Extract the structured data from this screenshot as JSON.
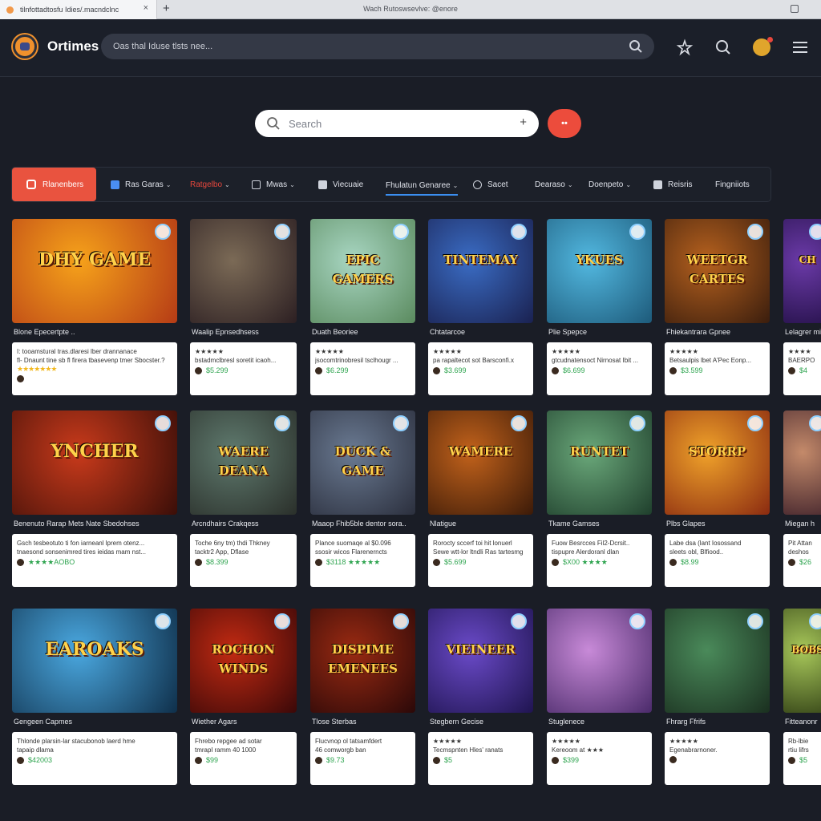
{
  "browser": {
    "tab_title": "tilnfottadtosfu Idies/.macndclnc",
    "tab_close": "×",
    "new_tab": "+",
    "window_title": "Wach Rutoswsevlve: @enore"
  },
  "header": {
    "brand": "Ortimes",
    "search_placeholder": "Oas thal Iduse tlsts nee..."
  },
  "main_search": {
    "placeholder": "Search",
    "add": "+",
    "go_label": "••"
  },
  "categories": {
    "active": "Rlanenbers",
    "items": [
      {
        "label": "Ras Garas",
        "chevron": "⌄",
        "icon_color": "#4a8ef2"
      },
      {
        "label": "Ratgelbo",
        "chevron": "⌄",
        "icon_color": "",
        "accent": "#e8473c"
      },
      {
        "label": "Mwas",
        "chevron": "⌄",
        "icon_color": "#cfd3dc"
      },
      {
        "label": "Viecuaie",
        "chevron": "",
        "icon_color": "#cfd3dc"
      },
      {
        "label": "Fhulatun Genaree",
        "chevron": "⌄",
        "icon_color": ""
      },
      {
        "label": "Sacet",
        "chevron": "",
        "icon_color": "#cfd3dc"
      },
      {
        "label": "Dearaso",
        "chevron": "⌄",
        "icon_color": ""
      },
      {
        "label": "Doenpeto",
        "chevron": "⌄",
        "icon_color": ""
      },
      {
        "label": "Reisris",
        "chevron": "",
        "icon_color": "#cfd3dc"
      },
      {
        "label": "Fingniiots",
        "chevron": "",
        "icon_color": ""
      }
    ]
  },
  "games": [
    {
      "title": "Blone Epecertpte ..",
      "art": "DHY GAME",
      "colors": [
        "#f6a21a",
        "#b53b16"
      ],
      "line1": "I: tooamstural tras.dlaresi lber drannanace",
      "line2": "fl- Dnaunt tine sb fl firera tbasevenp tmer Sbocster.?",
      "stars": "★★★★★★★",
      "price": ""
    },
    {
      "title": "Waalip Epnsedhsess",
      "art": "",
      "colors": [
        "#7b6a56",
        "#2c1f22"
      ],
      "line1": "★★★★★",
      "line2": "bstadmclbresl soretit icaoh...",
      "stars": "",
      "price": "$5.299"
    },
    {
      "title": "Duath Beoriee",
      "art": "EPIC GAMERS",
      "colors": [
        "#a8d6c2",
        "#5a8a5e"
      ],
      "line1": "★★★★★",
      "line2": "jsocomtrinobresil tsclhougr ...",
      "stars": "",
      "price": "$6.299"
    },
    {
      "title": "Chtatarcoe",
      "art": "TINTEMAY",
      "colors": [
        "#3a6cc4",
        "#1a2150"
      ],
      "line1": "★★★★★",
      "line2": "pa rapaltecot sot Barsconfi.x",
      "stars": "",
      "price": "$3.699"
    },
    {
      "title": "Plie Spepce",
      "art": "YKUES",
      "colors": [
        "#52b8e0",
        "#1d5a7a"
      ],
      "line1": "★★★★★",
      "line2": "gtcudnatensoct Nirnosat Ibit ...",
      "stars": "",
      "price": "$6.699"
    },
    {
      "title": "Fhiekantrara Gpnee",
      "art": "WEETGR CARTES",
      "colors": [
        "#b6611e",
        "#3a1d0d"
      ],
      "line1": "★★★★★",
      "line2": "Betsaulpis lbet A'Pec Eonp...",
      "stars": "",
      "price": "$3.599"
    },
    {
      "title": "Lelagrer mi",
      "art": "CH",
      "colors": [
        "#6b3aa8",
        "#2a1450"
      ],
      "line1": "★★★★",
      "line2": "BAERPO",
      "stars": "",
      "price": "$4"
    },
    {
      "title": "Benenuto Rarap Mets Nate Sbedohses",
      "art": "YNCHER",
      "colors": [
        "#c93a1b",
        "#3a0e08"
      ],
      "line1": "Gsch tesbeotuto ti fon iarneanl lprem otenz...",
      "line2": "tnaesond sonsenimred tires ieidas mam nst...",
      "stars": "",
      "price": "★★★★AOBO"
    },
    {
      "title": "Arcndhairs Crakqess",
      "art": "WAERE DEANA",
      "colors": [
        "#5f7a6e",
        "#2a2f2a"
      ],
      "line1": "Toche 6ny tm) thdi Thkney",
      "line2": "tacktr2 App, Dflase",
      "stars": "",
      "price": "$8.399"
    },
    {
      "title": "Maaop Fhib5ble dentor sora..",
      "art": "DUCK & GAME",
      "colors": [
        "#6a7a92",
        "#2b2f3d"
      ],
      "line1": "Plance suomaqe al $0.096",
      "line2": "ssosir wicos Flarenerncts",
      "stars": "",
      "price": "$3118 ★★★★★"
    },
    {
      "title": "Nlatigue",
      "art": "WAMERE",
      "colors": [
        "#c2621b",
        "#3b1a08"
      ],
      "line1": "Rorocty sccerf toi hit lonuerl",
      "line2": "Sewe wtt-lor ltndli Ras tartesmg",
      "stars": "",
      "price": "$5.699"
    },
    {
      "title": "Tkame Gamses",
      "art": "RUNTET",
      "colors": [
        "#6aa87a",
        "#1f3f2c"
      ],
      "line1": "Fuow Besrcces Fil2-Dcrsit..",
      "line2": "tispupre Alerdoranl dlan",
      "stars": "",
      "price": "$X00 ★★★★"
    },
    {
      "title": "Plbs Glapes",
      "art": "STORRP",
      "colors": [
        "#f0a22a",
        "#8a2a10"
      ],
      "line1": "Labe dsa (lant Iosossand",
      "line2": "sleets obl, Blfiood..",
      "stars": "",
      "price": "$8.99"
    },
    {
      "title": "Miegan h",
      "art": "",
      "colors": [
        "#c48a6a",
        "#4a2a30"
      ],
      "line1": "Pit Attan",
      "line2": "deshos",
      "stars": "",
      "price": "$26"
    },
    {
      "title": "Gengeen Capmes",
      "art": "EAROAKS",
      "colors": [
        "#4aa8e0",
        "#0f2f4a"
      ],
      "line1": "Thlonde plarsin-lar stacubonob laerd hme",
      "line2": "tapaip dlama",
      "stars": "",
      "price": "$42003"
    },
    {
      "title": "Wiether Agars",
      "art": "ROCHON WINDS",
      "colors": [
        "#c22a12",
        "#3a0808"
      ],
      "line1": "Fhrebo repgee ad sotar",
      "line2": "tmrapl ramm 40 1000",
      "stars": "",
      "price": "$99"
    },
    {
      "title": "Tlose Sterbas",
      "art": "DISPIME EMENEES",
      "colors": [
        "#9a2a12",
        "#2a0808"
      ],
      "line1": "Flucvnop ol tatsamfdert",
      "line2": "46 comworgb ban",
      "stars": "",
      "price": "$9.73"
    },
    {
      "title": "Stegbern Gecise",
      "art": "VIEINEER",
      "colors": [
        "#6a4ac8",
        "#1f1450"
      ],
      "line1": "★★★★★",
      "line2": "Tecmspnten Hles' ranats",
      "stars": "",
      "price": "$5"
    },
    {
      "title": "Stuglenece",
      "art": "",
      "colors": [
        "#c88ad8",
        "#4a2a6a"
      ],
      "line1": "★★★★★",
      "line2": "Kereoom at ★★★",
      "stars": "",
      "price": "$399"
    },
    {
      "title": "Fhrarg Ffrifs",
      "art": "",
      "colors": [
        "#4a8a5a",
        "#1a2f1f"
      ],
      "line1": "★★★★★",
      "line2": "Egenabrarnoner.",
      "stars": "",
      "price": ""
    },
    {
      "title": "Fitteanonr",
      "art": "BOBS",
      "colors": [
        "#a8c85a",
        "#3a4a1a"
      ],
      "line1": "Rb-lbie",
      "line2": "rtiu lifrs",
      "stars": "",
      "price": "$5"
    }
  ]
}
